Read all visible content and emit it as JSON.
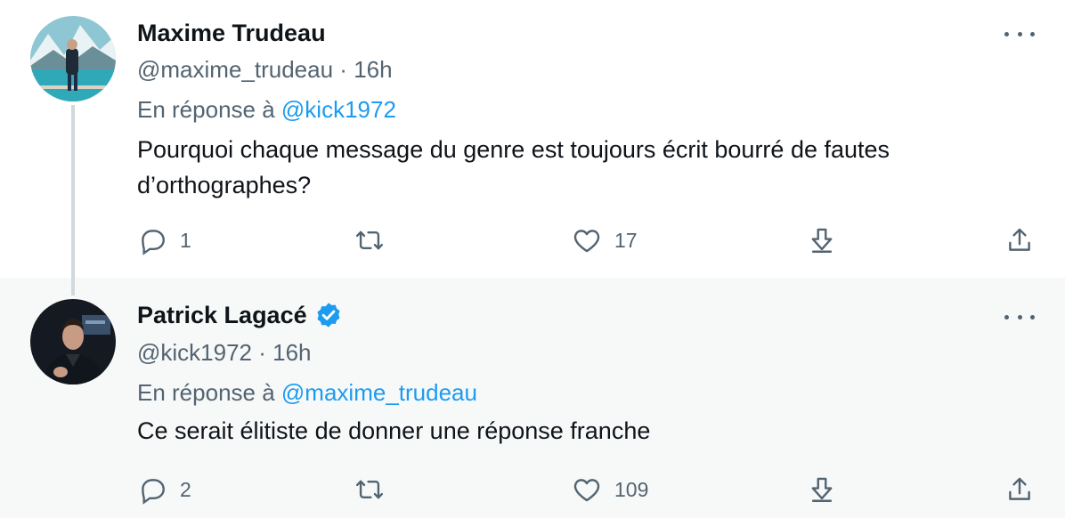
{
  "tweets": [
    {
      "name": "Maxime Trudeau",
      "handle": "@maxime_trudeau",
      "time": "16h",
      "reply_prefix": "En réponse à",
      "reply_mention": "@kick1972",
      "text": "Pourquoi chaque message du genre est toujours écrit bourré de fautes d’orthographes?",
      "replies": "1",
      "retweets": "",
      "likes": "17",
      "verified": false
    },
    {
      "name": "Patrick Lagacé",
      "handle": "@kick1972",
      "time": "16h",
      "reply_prefix": "En réponse à",
      "reply_mention": "@maxime_trudeau",
      "text": "Ce serait élitiste de donner une réponse franche",
      "replies": "2",
      "retweets": "",
      "likes": "109",
      "verified": true
    }
  ],
  "colors": {
    "accent": "#1d9bf0",
    "muted": "#536471",
    "text": "#0f1419",
    "thread_line": "#cfd9de",
    "second_bg": "#f7f9f9"
  },
  "icons": [
    "avatar",
    "more-icon",
    "reply-icon",
    "retweet-icon",
    "like-icon",
    "bookmark-icon",
    "share-icon",
    "verified-badge-icon"
  ]
}
